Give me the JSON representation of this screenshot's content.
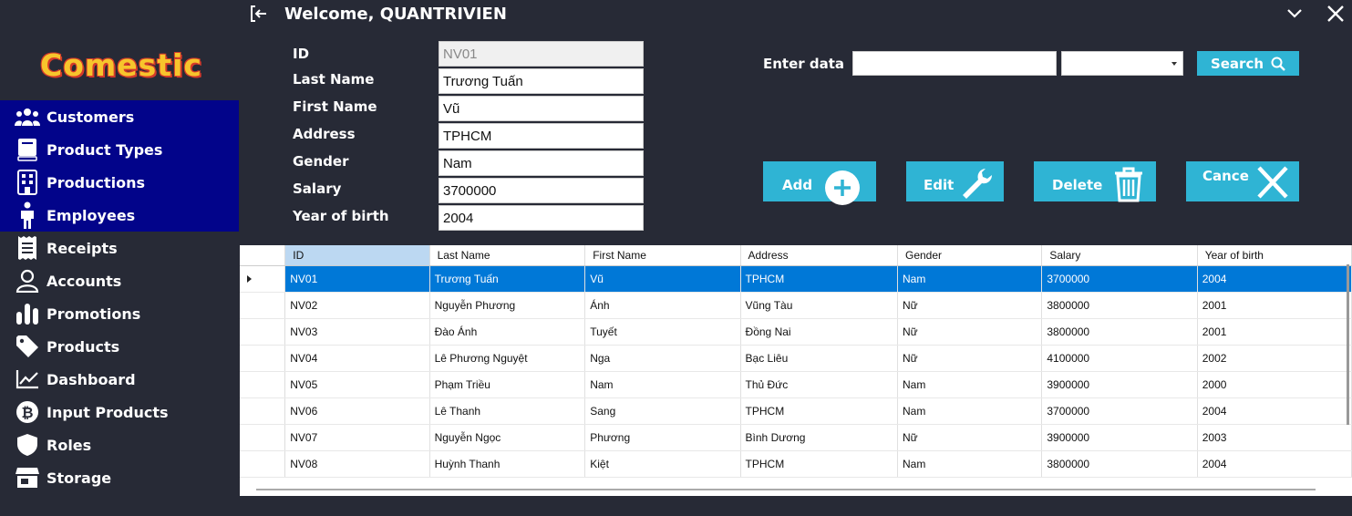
{
  "header": {
    "welcome": "Welcome, QUANTRIVIEN"
  },
  "logo": {
    "text": "Comestic"
  },
  "sidebar": {
    "items": [
      {
        "label": "Customers",
        "icon": "users-icon"
      },
      {
        "label": "Product Types",
        "icon": "book-icon"
      },
      {
        "label": "Productions",
        "icon": "building-icon"
      },
      {
        "label": "Employees",
        "icon": "person-icon"
      },
      {
        "label": "Receipts",
        "icon": "receipt-icon"
      },
      {
        "label": "Accounts",
        "icon": "user-icon"
      },
      {
        "label": "Promotions",
        "icon": "bar-chart-icon"
      },
      {
        "label": "Products",
        "icon": "tag-icon"
      },
      {
        "label": "Dashboard",
        "icon": "line-chart-icon"
      },
      {
        "label": "Input Products",
        "icon": "bitcoin-icon"
      },
      {
        "label": "Roles",
        "icon": "shield-icon"
      },
      {
        "label": "Storage",
        "icon": "store-icon"
      }
    ],
    "active_color": "#02048a"
  },
  "form": {
    "id": {
      "label": "ID",
      "value": "NV01"
    },
    "last_name": {
      "label": "Last Name",
      "value": "Trương Tuấn"
    },
    "first_name": {
      "label": "First Name",
      "value": "Vũ"
    },
    "address": {
      "label": "Address",
      "value": "TPHCM"
    },
    "gender": {
      "label": "Gender",
      "value": "Nam"
    },
    "salary": {
      "label": "Salary",
      "value": "3700000"
    },
    "year_of_birth": {
      "label": "Year of birth",
      "value": "2004"
    }
  },
  "search": {
    "label": "Enter data",
    "value": "",
    "select_value": "",
    "button": "Search"
  },
  "actions": {
    "add": "Add",
    "edit": "Edit",
    "delete": "Delete",
    "cancel": "Cance",
    "accent": "#2fb4d4"
  },
  "grid": {
    "columns": [
      "ID",
      "Last Name",
      "First Name",
      "Address",
      "Gender",
      "Salary",
      "Year of birth"
    ],
    "rows": [
      [
        "NV01",
        "Trương Tuấn",
        "Vũ",
        "TPHCM",
        "Nam",
        "3700000",
        "2004"
      ],
      [
        "NV02",
        "Nguyễn Phương",
        "Ánh",
        "Vũng Tàu",
        "Nữ",
        "3800000",
        "2001"
      ],
      [
        "NV03",
        "Đào Ánh",
        "Tuyết",
        "Đồng Nai",
        "Nữ",
        "3800000",
        "2001"
      ],
      [
        "NV04",
        "Lê Phương Nguyệt",
        "Nga",
        "Bạc Liêu",
        "Nữ",
        "4100000",
        "2002"
      ],
      [
        "NV05",
        "Phạm Triều",
        "Nam",
        "Thủ Đức",
        "Nam",
        "3900000",
        "2000"
      ],
      [
        "NV06",
        "Lê Thanh",
        "Sang",
        "TPHCM",
        "Nam",
        "3700000",
        "2004"
      ],
      [
        "NV07",
        "Nguyễn Ngọc",
        "Phương",
        "Bình Dương",
        "Nữ",
        "3900000",
        "2003"
      ],
      [
        "NV08",
        "Huỳnh Thanh",
        "Kiệt",
        "TPHCM",
        "Nam",
        "3800000",
        "2004"
      ]
    ],
    "selection_color": "#0078d7"
  }
}
